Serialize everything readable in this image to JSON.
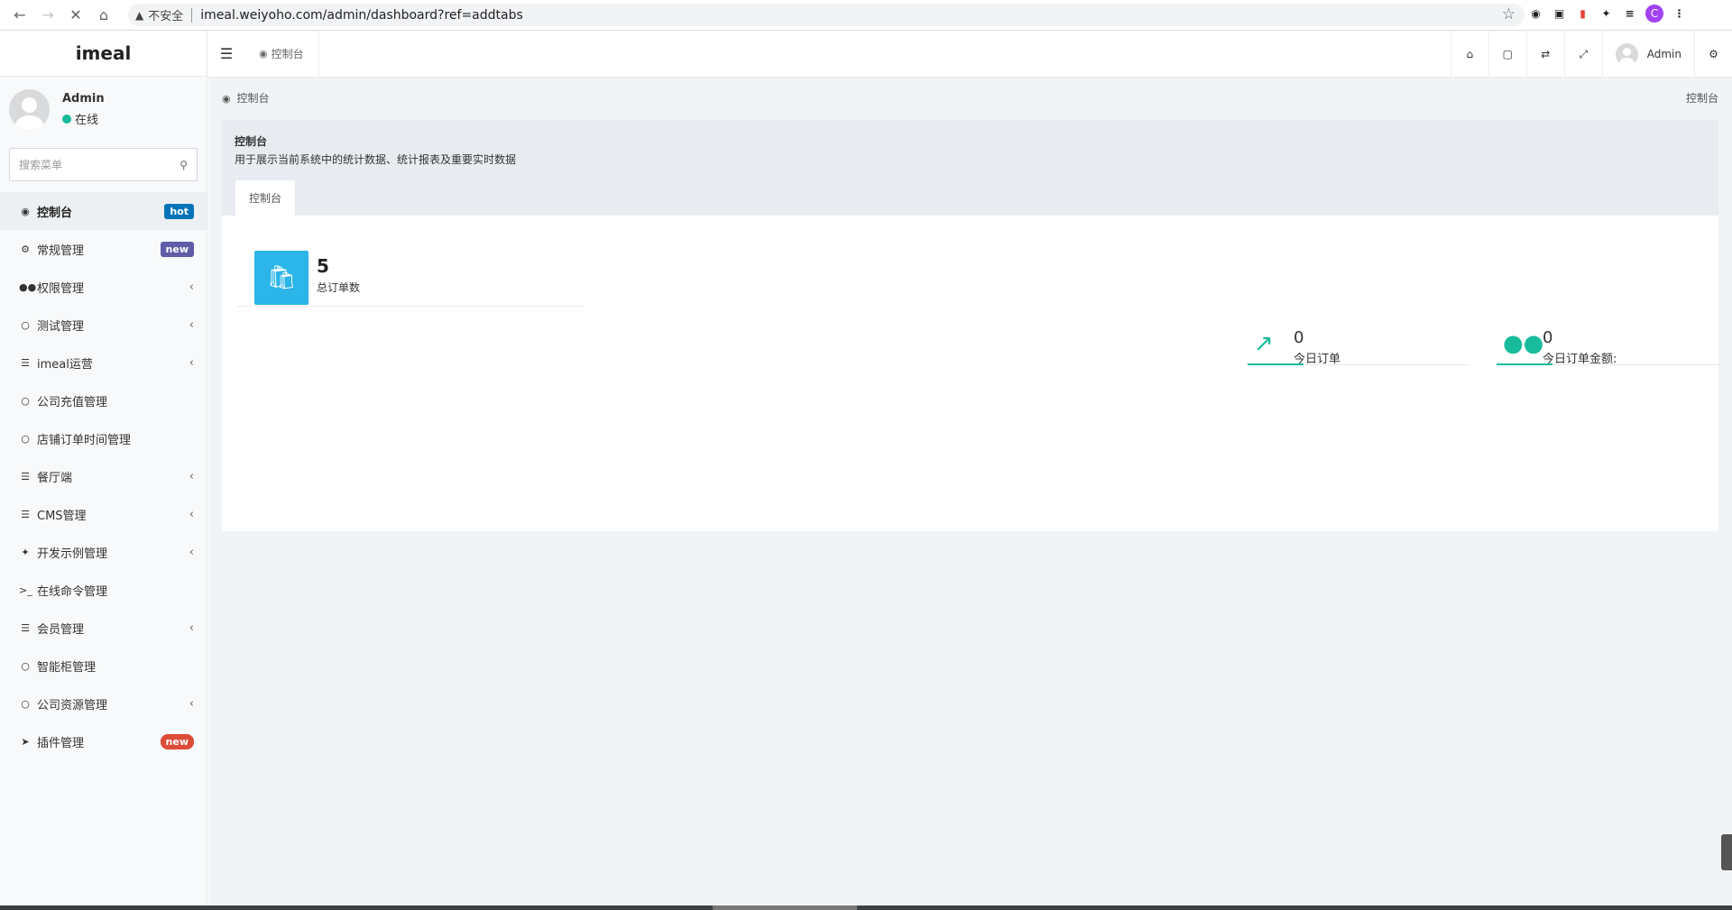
{
  "browser": {
    "back_icon": "arrow-left-icon",
    "forward_icon": "arrow-right-icon",
    "reload_icon": "close-icon",
    "home_icon": "home-icon",
    "insecure_label": "不安全",
    "url": "imeal.weiyoho.com/admin/dashboard?ref=addtabs",
    "profile_initial": "C"
  },
  "sidebar": {
    "logo": "imeal",
    "user": {
      "name": "Admin",
      "status": "在线"
    },
    "search_placeholder": "搜索菜单",
    "items": [
      {
        "label": "控制台",
        "icon": "dashboard-icon",
        "badge": "hot",
        "active": true
      },
      {
        "label": "常规管理",
        "icon": "cogs-icon",
        "badge": "new"
      },
      {
        "label": "权限管理",
        "icon": "group-icon",
        "chevron": true
      },
      {
        "label": "测试管理",
        "icon": "circle-icon",
        "chevron": true
      },
      {
        "label": "imeal运营",
        "icon": "list-icon",
        "chevron": true
      },
      {
        "label": "公司充值管理",
        "icon": "circle-icon"
      },
      {
        "label": "店铺订单时间管理",
        "icon": "circle-icon"
      },
      {
        "label": "餐厅端",
        "icon": "list-icon",
        "chevron": true
      },
      {
        "label": "CMS管理",
        "icon": "list-icon",
        "chevron": true
      },
      {
        "label": "开发示例管理",
        "icon": "magic-icon",
        "chevron": true
      },
      {
        "label": "在线命令管理",
        "icon": "terminal-icon"
      },
      {
        "label": "会员管理",
        "icon": "list-icon",
        "chevron": true
      },
      {
        "label": "智能柜管理",
        "icon": "circle-icon"
      },
      {
        "label": "公司资源管理",
        "icon": "circle-icon",
        "chevron": true
      },
      {
        "label": "插件管理",
        "icon": "rocket-icon",
        "badge": "new"
      }
    ]
  },
  "topbar": {
    "tab_label": "控制台",
    "user_name": "Admin"
  },
  "breadcrumb": {
    "left": "控制台",
    "right": "控制台"
  },
  "panel": {
    "title": "控制台",
    "description": "用于展示当前系统中的统计数据、统计报表及重要实时数据",
    "tab": "控制台"
  },
  "stats": {
    "total_orders": {
      "value": "5",
      "label": "总订单数",
      "icon": "shopping-bag-icon"
    },
    "today_orders": {
      "value": "0",
      "label": "今日订单",
      "icon": "line-chart-icon"
    },
    "today_amount": {
      "value": "0",
      "label": "今日订单金额:",
      "icon": "users-icon"
    }
  },
  "colors": {
    "accent": "#18bc9c",
    "info": "#2bb5e8",
    "hot": "#0073b7",
    "new_purple": "#605ca8",
    "new_red": "#dd4b39"
  }
}
